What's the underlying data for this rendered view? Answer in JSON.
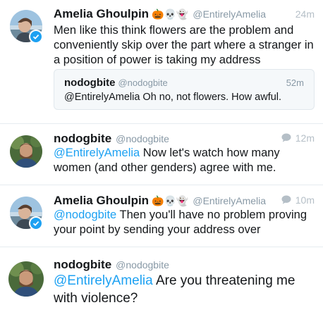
{
  "tweets": [
    {
      "name": "Amelia Ghoulpin",
      "emoji": "🎃💀👻",
      "handle": "@EntirelyAmelia",
      "time": "24m",
      "text": "Men like this think flowers are the problem and conveniently skip over the part where a stranger in a position of power is taking my address",
      "verified": true,
      "quoted": {
        "name": "nodogbite",
        "handle": "@nodogbite",
        "time": "52m",
        "text": "@EntirelyAmelia Oh no, not flowers.  How awful."
      }
    },
    {
      "name": "nodogbite",
      "handle": "@nodogbite",
      "time": "12m",
      "mention": "@EntirelyAmelia",
      "text": " Now let's watch how many women (and other genders) agree with me.",
      "icon": "reply-bubble-icon"
    },
    {
      "name": "Amelia Ghoulpin",
      "emoji": "🎃💀👻",
      "handle": "@EntirelyAmelia",
      "time": "10m",
      "mention": "@nodogbite",
      "text": " Then you'll have no problem proving your point by sending your address over",
      "verified": true,
      "icon": "reply-bubble-icon"
    },
    {
      "name": "nodogbite",
      "handle": "@nodogbite",
      "mention": "@EntirelyAmelia",
      "text": " Are you threatening me with violence?"
    }
  ],
  "colors": {
    "link": "#1da1f2",
    "muted": "#8899a6",
    "divider": "#e6ecf0",
    "quote_bg": "#f5f8fa"
  }
}
